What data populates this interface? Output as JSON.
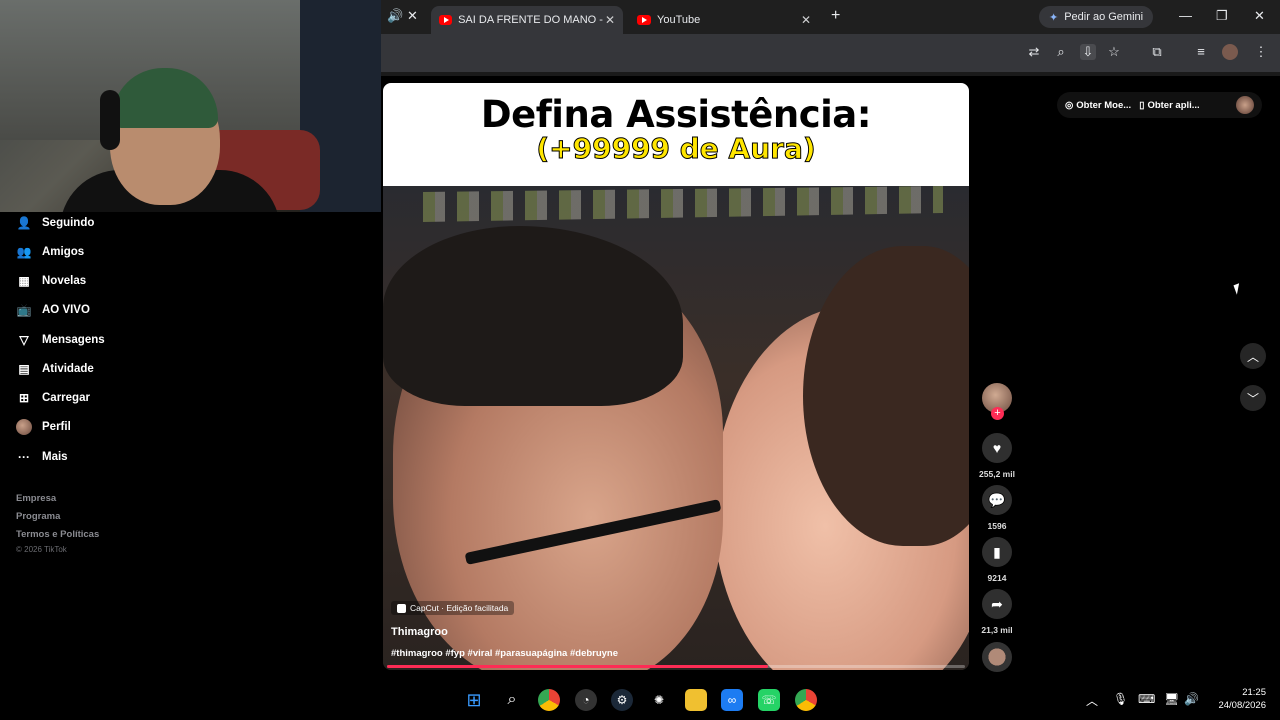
{
  "browser": {
    "tabs": [
      {
        "label": "SAI DA FRENTE DO MANO - M",
        "active": true
      },
      {
        "label": "YouTube",
        "active": false
      }
    ],
    "gemini_button": "Pedir ao Gemini"
  },
  "sidebar": {
    "items": [
      {
        "label": "Seguindo",
        "icon": "following-icon"
      },
      {
        "label": "Amigos",
        "icon": "friends-icon"
      },
      {
        "label": "Novelas",
        "icon": "novelas-icon"
      },
      {
        "label": "AO VIVO",
        "icon": "live-icon"
      },
      {
        "label": "Mensagens",
        "icon": "messages-icon"
      },
      {
        "label": "Atividade",
        "icon": "activity-icon"
      },
      {
        "label": "Carregar",
        "icon": "upload-icon"
      },
      {
        "label": "Perfil",
        "icon": "profile-avatar"
      },
      {
        "label": "Mais",
        "icon": "more-icon"
      }
    ],
    "footer": {
      "empresa": "Empresa",
      "programa": "Programa",
      "termos": "Termos e Políticas",
      "copyright": "© 2026 TikTok"
    }
  },
  "video": {
    "banner_title": "Defina Assistência:",
    "banner_subtitle": "(+99999 de Aura)",
    "capcut_label": "CapCut · Edição facilitada",
    "author": "Thimagroo",
    "hashtags": "#thimagroo #fyp #viral #parasuapágina #debruyne",
    "progress": 0.66
  },
  "actions": {
    "likes": "255,2 mil",
    "comments": "1596",
    "saves": "9214",
    "shares": "21,3 mil"
  },
  "top_right": {
    "coins": "Obter Moe...",
    "app": "Obter apli..."
  },
  "clock": {
    "time": "21:25",
    "date": "24/08/2026"
  },
  "colors": {
    "accent": "#fe2c55",
    "banner_yellow": "#ffe600"
  }
}
